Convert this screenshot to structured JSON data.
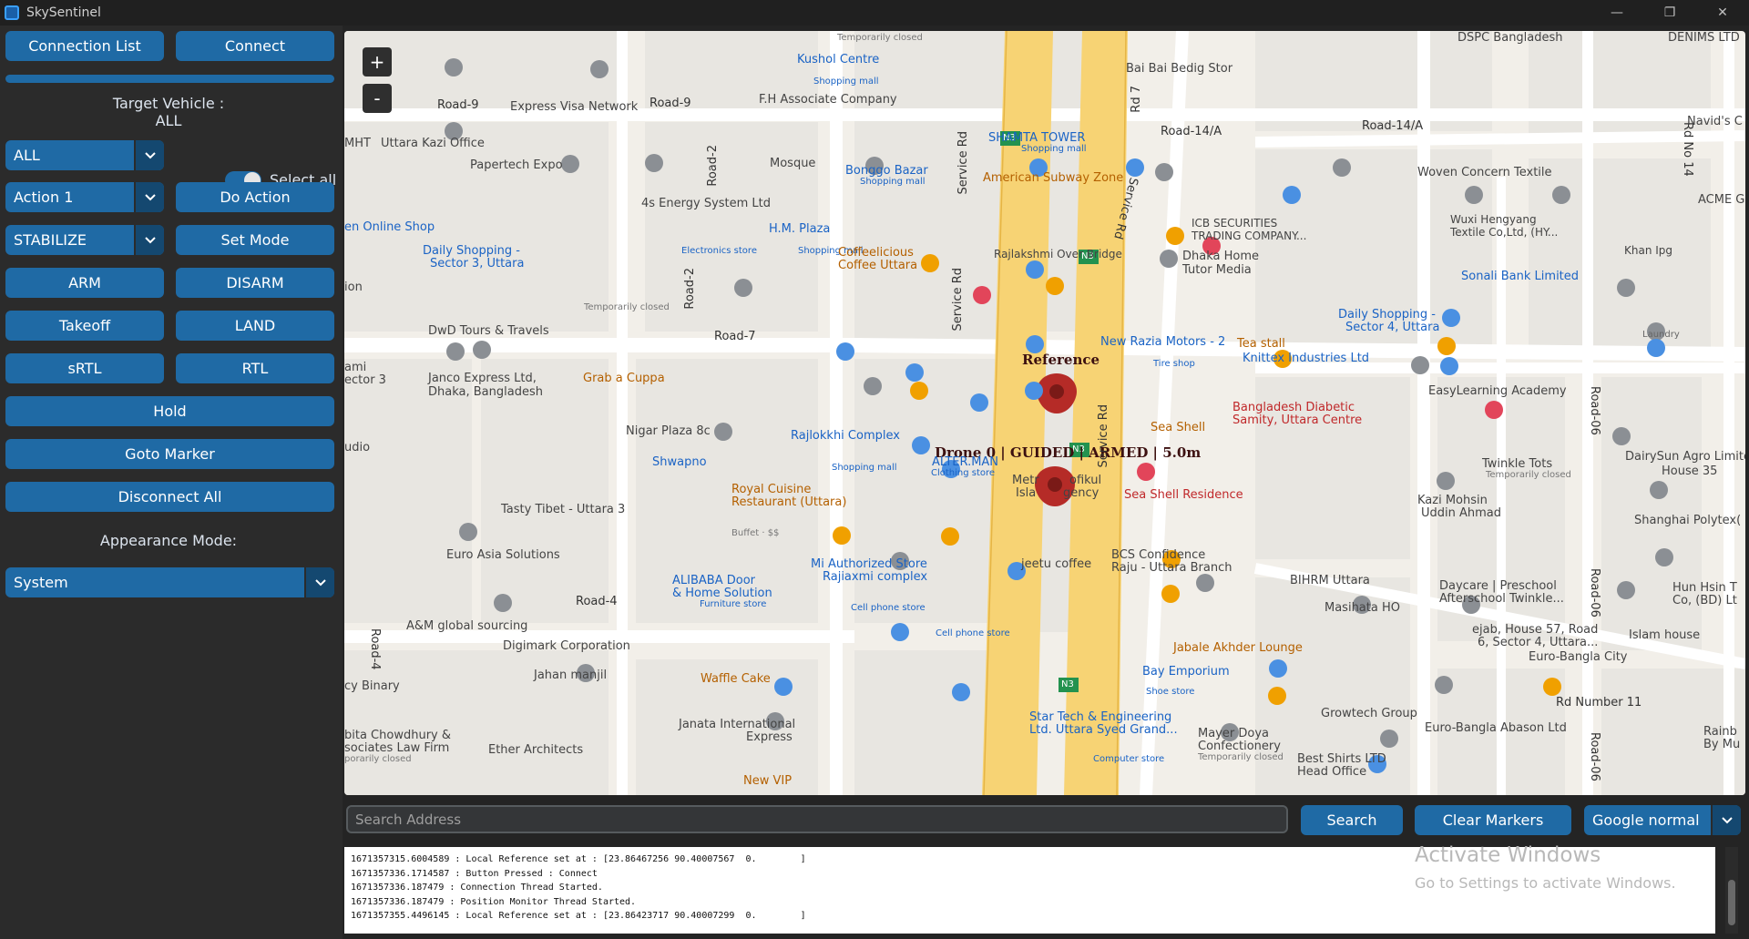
{
  "window": {
    "title": "SkySentinel",
    "controls": [
      "—",
      "❐",
      "✕"
    ]
  },
  "sidebar": {
    "connection_list": "Connection List",
    "connect": "Connect",
    "target_vehicle_label": "Target Vehicle :",
    "target_vehicle_value": "ALL",
    "vehicle_select": "ALL",
    "select_all": "Select all",
    "select_all_on": true,
    "action_select": "Action 1",
    "do_action": "Do Action",
    "mode_select": "STABILIZE",
    "set_mode": "Set Mode",
    "arm": "ARM",
    "disarm": "DISARM",
    "takeoff": "Takeoff",
    "land": "LAND",
    "srtl": "sRTL",
    "rtl": "RTL",
    "hold": "Hold",
    "goto_marker": "Goto Marker",
    "disconnect_all": "Disconnect All",
    "appearance_label": "Appearance Mode:",
    "appearance_select": "System"
  },
  "map": {
    "zoom_in": "+",
    "zoom_out": "-",
    "reference_label": "Reference",
    "drone_label": "Drone 0 | GUIDED | ARMED | 5.0m",
    "labels": {
      "road9a": "Road-9",
      "road9b": "Road-9",
      "road7": "Road-7",
      "road4": "Road-4",
      "road14a": "Road-14/A",
      "road14a2": "Road-14/A",
      "road2a": "Road-2",
      "road2b": "Road-2",
      "road06a": "Road-06",
      "road06b": "Road-06",
      "road06c": "Road-06",
      "road4v": "Road-4",
      "rdno11": "Rd Number 11",
      "rdno14": "Rd No 14",
      "rd7": "Rd 7",
      "service1": "Service Rd",
      "service2": "Service Rd",
      "service3": "Service Rd",
      "service4": "Service Rd",
      "express_visa": "Express Visa Network",
      "uttara_kazi": "Uttara Kazi Office",
      "papertech": "Papertech Expo",
      "kushol": "Kushol Centre",
      "kushol_sub": "Shopping mall",
      "fh_assoc": "F.H Associate Company",
      "mosque": "Mosque",
      "bongo": "Bonggo Bazar",
      "bongo_sub": "Shopping mall",
      "shamta": "SHAMTA TOWER",
      "shamta_sub": "Shopping mall",
      "subway": "American Subway Zone",
      "bai_bai": "Bai Bai Bedig Stor",
      "dspc": "DSPC Bangladesh",
      "denims": "DENIMS LTD",
      "navids": "Navid's C",
      "woven": "Woven Concern Textile",
      "acme": "ACME Ga",
      "icb": "ICB SECURITIES",
      "icb2": "TRADING COMPANY...",
      "wuxi": "Wuxi Hengyang",
      "wuxi2": "Textile Co,Ltd, (HY...",
      "khan": "Khan Ipg",
      "dhaka_home": "Dhaka Home",
      "dhaka_home2": "Tutor Media",
      "sonali": "Sonali Bank Limited",
      "daily4": "Daily Shopping -",
      "daily4b": "Sector 4, Uttara",
      "laundry": "Laundry",
      "energy": "4s Energy System Ltd",
      "online_shop": "en Online Shop",
      "daily3": "Daily Shopping -",
      "daily3b": "Sector 3, Uttara",
      "hm_plaza": "H.M. Plaza",
      "electronics": "Electronics store",
      "hm_sub": "Shopping mall",
      "coffelicious": "Coffeelicious",
      "coffelicious2": "Coffee Uttara",
      "rajlakshmi": "Rajlakshmi Over Bridge",
      "temp_closed1": "Temporarily closed",
      "temp_closed_top": "Temporarily closed",
      "dwd": "DwD Tours & Travels",
      "new_razia": "New Razia Motors - 2",
      "tea_stall": "Tea stall",
      "knittex": "Knittex Industries Ltd",
      "tire_shop": "Tire shop",
      "easylearning": "EasyLearning Academy",
      "janco": "Janco Express Ltd,",
      "janco2": "Dhaka, Bangladesh",
      "grab": "Grab a Cuppa",
      "bd_diabetic": "Bangladesh Diabetic",
      "bd_diabetic2": "Samity, Uttara Centre",
      "sea_shell": "Sea Shell",
      "nigar": "Nigar Plaza 8c",
      "rajlokkhi": "Rajlokkhi Complex",
      "rajlokkhi_sub": "Shopping mall",
      "alterman": "ALTER.MAN",
      "alterman_sub": "Clothing store",
      "shwapno": "Shwapno",
      "sea_shell_res": "Sea Shell Residence",
      "metro": "Metr",
      "agency": "Isla",
      "agency2": "gency",
      "ofikul": "ofikul",
      "twinkle": "Twinkle Tots",
      "twinkle_sub": "Temporarily closed",
      "dairysun": "DairySun Agro Limite",
      "house35": "House 35",
      "royal": "Royal Cuisine",
      "royal2": "Restaurant (Uttara)",
      "royal3": "Buffet · $$",
      "tasty": "Tasty Tibet - Uttara 3",
      "kazi": "Kazi Mohsin",
      "kazi2": "Uddin Ahmad",
      "shanghai": "Shanghai Polytex(",
      "euro_asia": "Euro Asia Solutions",
      "jeetu": "jeetu coffee",
      "bcs": "BCS Confidence",
      "bcs2": "Raju - Uttara Branch",
      "mi_store": "Mi Authorized Store",
      "rajiaxmi": "Rajiaxmi complex",
      "cellphone": "Cell phone store",
      "cellphone2": "Cell phone store",
      "bihrm": "BIHRM Uttara",
      "masihata": "Masihata HO",
      "daycare": "Daycare | Preschool",
      "daycare2": "Afterschool Twinkle...",
      "hun_hsin": "Hun Hsin T",
      "hun_hsin2": "Co, (BD) Lt",
      "ag_sourcing": "A&M global sourcing",
      "alibaba": "ALIBABA Door",
      "alibaba2": "& Home Solution",
      "alibaba3": "Furniture store",
      "ejab": "ejab, House 57, Road",
      "ejab2": "6, Sector 4, Uttara...",
      "islam_house": "Islam house",
      "digimark": "Digimark Corporation",
      "jabale": "Jabale Akhder Lounge",
      "euro_bangla": "Euro-Bangla City",
      "jahan": "Jahan manjil",
      "waffle": "Waffle Cake",
      "bay": "Bay Emporium",
      "bay_sub": "Shoe store",
      "growtech": "Growtech Group",
      "euro_abason": "Euro-Bangla Abason Ltd",
      "cy_binary": "cy Binary",
      "janata": "Janata International",
      "janata2": "Express",
      "star_tech": "Star Tech & Engineering",
      "star_tech2": "Ltd. Uttara Syed Grand...",
      "star_tech3": "Computer store",
      "mayer": "Mayer Doya",
      "mayer2": "Confectionery",
      "mayer3": "Temporarily closed",
      "best_shirts": "Best Shirts LTD",
      "best_shirts2": "Head Office",
      "rainb": "Rainb",
      "rainb2": "By Mu",
      "bita": "bita Chowdhury &",
      "bita2": "sociates Law Firm",
      "bita3": "porarily closed",
      "ether": "Ether Architects",
      "new_vip": "New VIP",
      "mht": "MHT",
      "ion": "ion",
      "ami": "ami",
      "ector3": "ector 3",
      "udio": "udio",
      "n3a": "N3",
      "n3b": "N3",
      "n3c": "N3",
      "n3d": "N3"
    }
  },
  "bottom": {
    "search_placeholder": "Search Address",
    "search_button": "Search",
    "clear_markers": "Clear Markers",
    "map_type": "Google normal",
    "log_lines": [
      "1671357315.6004589 : Local Reference set at : [23.86467256 90.40007567  0.        ]",
      "1671357336.1714587 : Button Pressed : Connect",
      "1671357336.187479 : Connection Thread Started.",
      "1671357336.187479 : Position Monitor Thread Started.",
      "1671357355.4496145 : Local Reference set at : [23.86423717 90.40007299  0.        ]"
    ],
    "watermark_title": "Activate Windows",
    "watermark_sub": "Go to Settings to activate Windows."
  },
  "colors": {
    "accent": "#1f6aa5",
    "accent_dark": "#144870",
    "sidebar_bg": "#2b2b2b",
    "window_bg": "#242424",
    "highway": "#f7d374",
    "marker": "#b52b27"
  }
}
